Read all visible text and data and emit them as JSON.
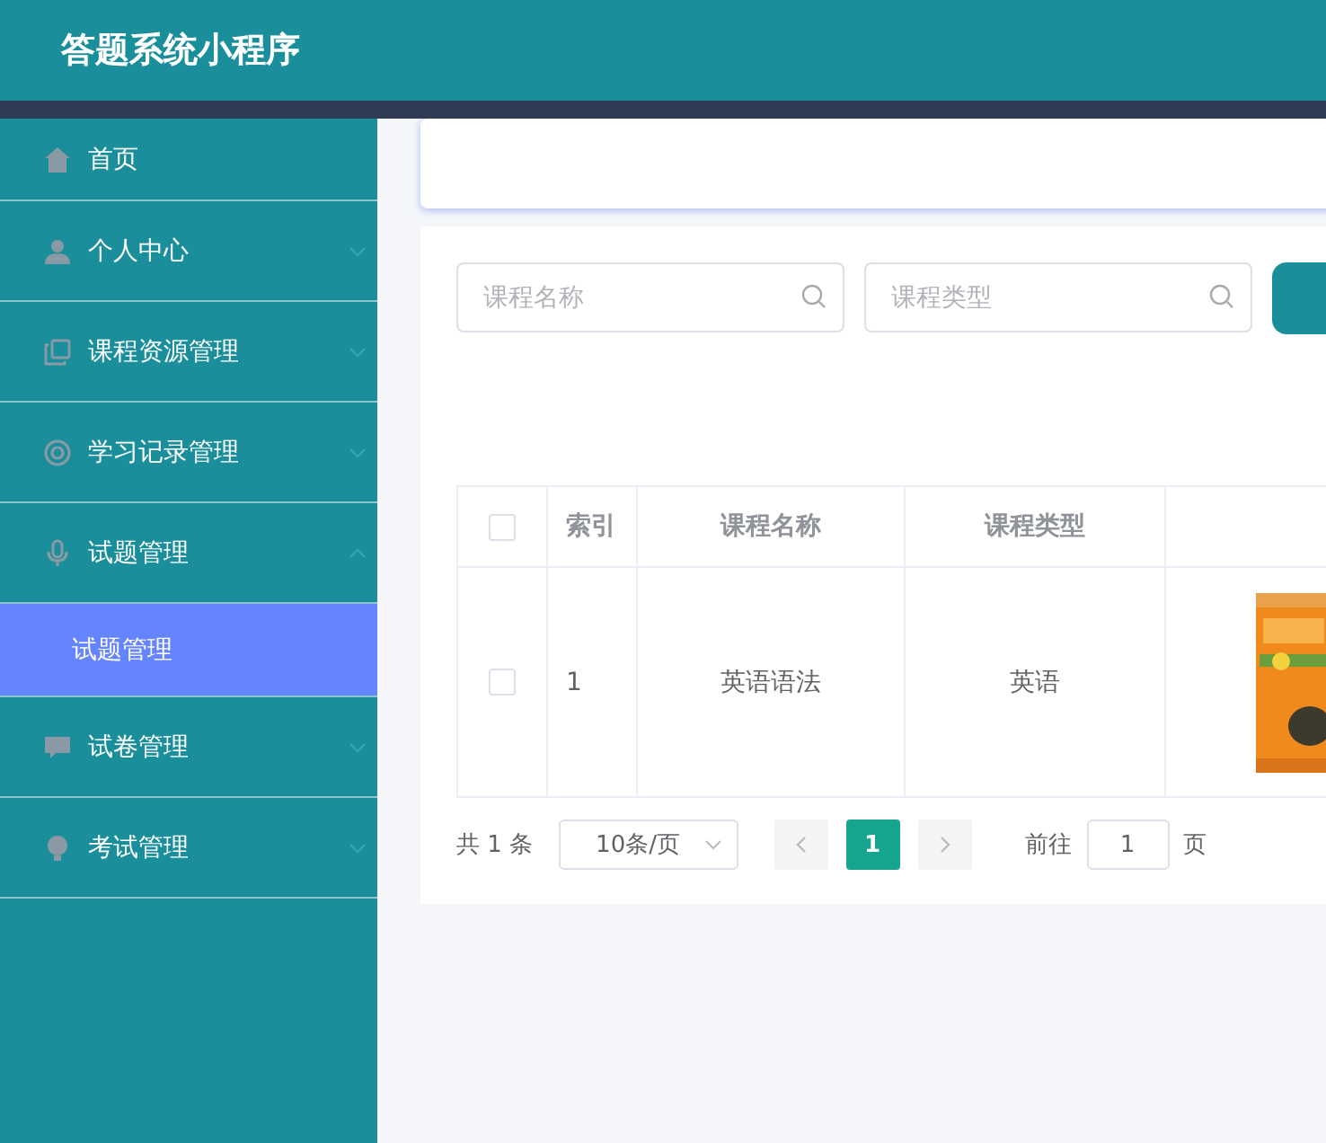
{
  "app_title": "答题系统小程序",
  "sidebar": {
    "items": [
      {
        "label": "首页",
        "kind": "link"
      },
      {
        "label": "个人中心",
        "kind": "menu",
        "expanded": false
      },
      {
        "label": "课程资源管理",
        "kind": "menu",
        "expanded": false
      },
      {
        "label": "学习记录管理",
        "kind": "menu",
        "expanded": false
      },
      {
        "label": "试题管理",
        "kind": "menu",
        "expanded": true,
        "children": [
          {
            "label": "试题管理",
            "selected": true
          }
        ]
      },
      {
        "label": "试卷管理",
        "kind": "menu",
        "expanded": false
      },
      {
        "label": "考试管理",
        "kind": "menu",
        "expanded": false
      }
    ]
  },
  "search": {
    "fields": [
      {
        "placeholder": "课程名称"
      },
      {
        "placeholder": "课程类型"
      }
    ]
  },
  "table": {
    "select_all": {
      "checked": false
    },
    "columns": [
      "索引",
      "课程名称",
      "课程类型"
    ],
    "rows": [
      {
        "checked": false,
        "cells": [
          "1",
          "英语语法",
          "英语"
        ]
      }
    ]
  },
  "pagination": {
    "total": "共 1 条",
    "page_size": "10条/页",
    "pages": [
      {
        "label": "1",
        "selected": true
      }
    ],
    "goto_label": "前往",
    "goto_value": "1",
    "page_unit": "页"
  }
}
